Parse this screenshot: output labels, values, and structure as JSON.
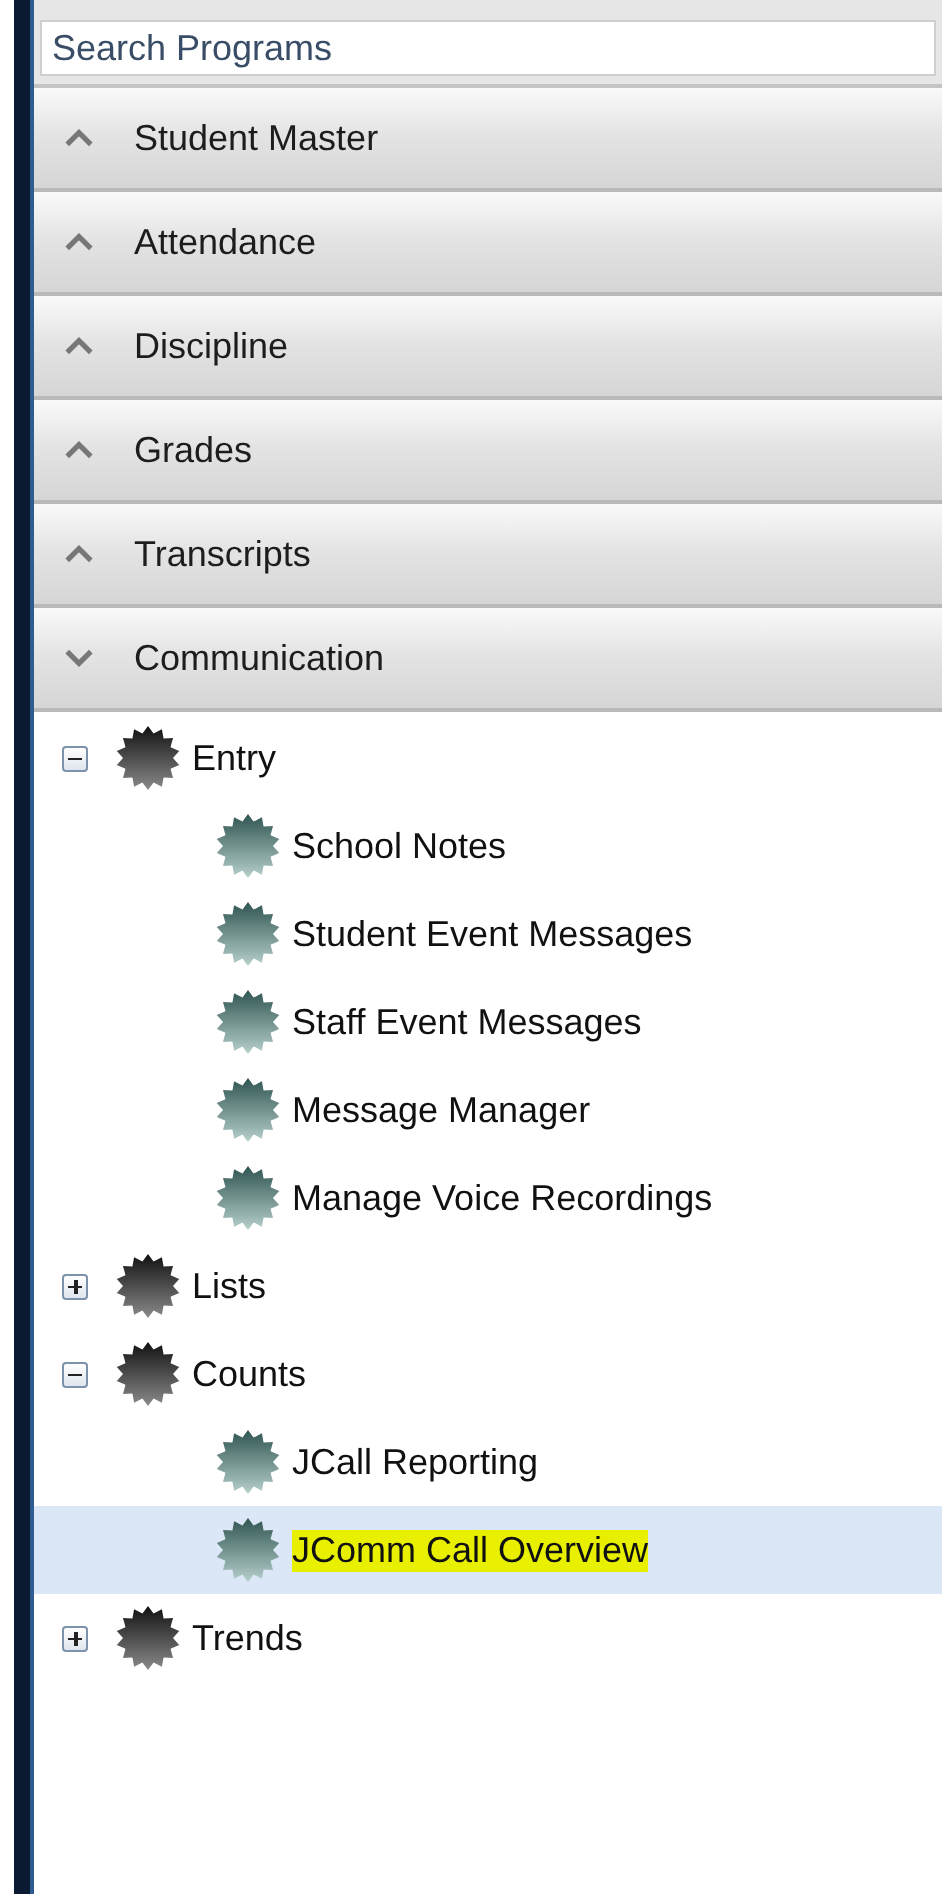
{
  "search": {
    "placeholder": "Search Programs"
  },
  "sections": [
    {
      "label": "Student Master",
      "expanded": false
    },
    {
      "label": "Attendance",
      "expanded": false
    },
    {
      "label": "Discipline",
      "expanded": false
    },
    {
      "label": "Grades",
      "expanded": false
    },
    {
      "label": "Transcripts",
      "expanded": false
    },
    {
      "label": "Communication",
      "expanded": true,
      "tree": [
        {
          "label": "Entry",
          "kind": "folder",
          "expanded": true,
          "selected": false,
          "children": [
            {
              "label": "School Notes",
              "kind": "program",
              "selected": false,
              "highlighted": false
            },
            {
              "label": "Student Event Messages",
              "kind": "program",
              "selected": false,
              "highlighted": false
            },
            {
              "label": "Staff Event Messages",
              "kind": "program",
              "selected": false,
              "highlighted": false
            },
            {
              "label": "Message Manager",
              "kind": "program",
              "selected": false,
              "highlighted": false
            },
            {
              "label": "Manage Voice Recordings",
              "kind": "program",
              "selected": false,
              "highlighted": false
            }
          ]
        },
        {
          "label": "Lists",
          "kind": "folder",
          "expanded": false,
          "selected": false
        },
        {
          "label": "Counts",
          "kind": "folder",
          "expanded": true,
          "selected": false,
          "children": [
            {
              "label": "JCall Reporting",
              "kind": "program",
              "selected": false,
              "highlighted": false
            },
            {
              "label": "JComm Call Overview",
              "kind": "program",
              "selected": true,
              "highlighted": true
            }
          ]
        },
        {
          "label": "Trends",
          "kind": "folder",
          "expanded": false,
          "selected": false
        }
      ]
    }
  ]
}
